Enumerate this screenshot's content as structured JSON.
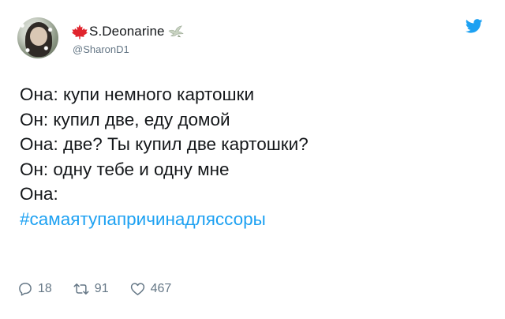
{
  "author": {
    "display_name": "S.Deonarine",
    "handle": "@SharonD1",
    "avatar_icon": "user-avatar",
    "name_prefix_icon": "maple-leaf-icon",
    "name_suffix_icon": "dove-icon"
  },
  "brand": {
    "icon": "twitter-bird-icon",
    "color": "#1da1f2"
  },
  "tweet": {
    "lines": [
      "Она: купи немного картошки",
      "Он: купил две, еду домой",
      "Она: две? Ты купил две картошки?",
      "Он: одну тебе и одну мне",
      "Она:"
    ],
    "hashtag": "#самаятупапричинадляссоры"
  },
  "actions": {
    "replies": "18",
    "retweets": "91",
    "likes": "467"
  },
  "colors": {
    "text": "#14171a",
    "secondary": "#657786",
    "link": "#1da1f2",
    "maple": "#e0242d"
  }
}
